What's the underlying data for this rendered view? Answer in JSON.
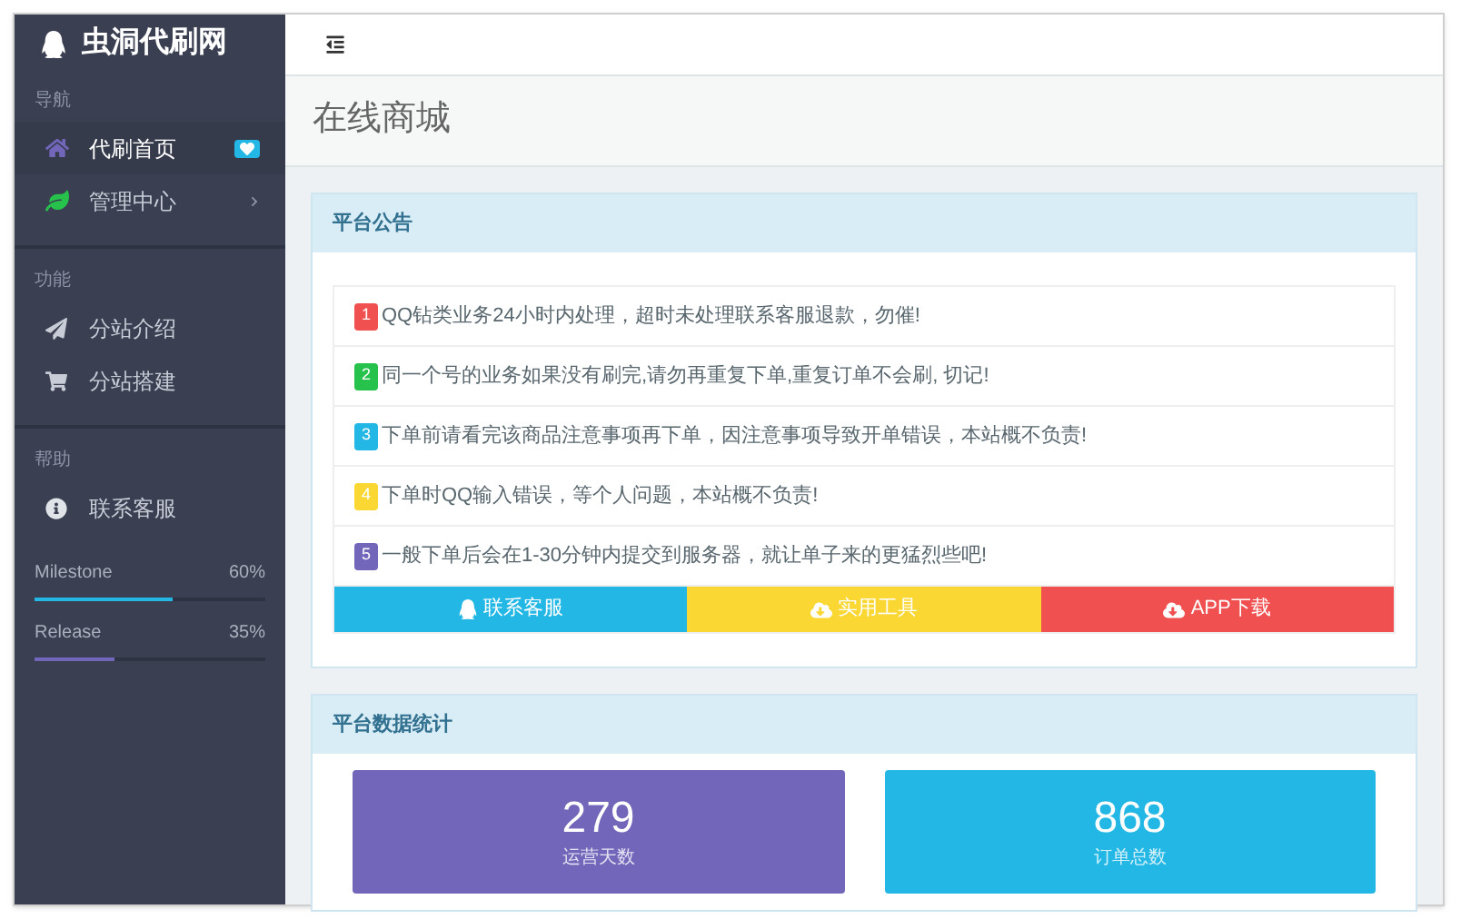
{
  "sidebar": {
    "brand": "虫洞代刷网",
    "sections": [
      {
        "heading": "导航",
        "items": [
          {
            "label": "代刷首页",
            "selected": true,
            "badge": true,
            "expandable": false
          },
          {
            "label": "管理中心",
            "selected": false,
            "badge": false,
            "expandable": true
          }
        ]
      },
      {
        "heading": "功能",
        "items": [
          {
            "label": "分站介绍",
            "selected": false,
            "badge": false,
            "expandable": false
          },
          {
            "label": "分站搭建",
            "selected": false,
            "badge": false,
            "expandable": false
          }
        ]
      },
      {
        "heading": "帮助",
        "items": [
          {
            "label": "联系客服",
            "selected": false,
            "badge": false,
            "expandable": false
          }
        ]
      }
    ],
    "progress": [
      {
        "label": "Milestone",
        "reading": "60%",
        "level": 0.6,
        "color": "#23b7e5"
      },
      {
        "label": "Release",
        "reading": "35%",
        "level": 0.35,
        "color": "#7266ba"
      }
    ]
  },
  "page_title": "在线商城",
  "notice": {
    "title": "平台公告",
    "items": [
      {
        "number": "1",
        "color": "#f05050",
        "text": "QQ钻类业务24小时内处理，超时未处理联系客服退款，勿催!"
      },
      {
        "number": "2",
        "color": "#27c24c",
        "text": "同一个号的业务如果没有刷完,请勿再重复下单,重复订单不会刷, 切记!"
      },
      {
        "number": "3",
        "color": "#23b7e5",
        "text": "下单前请看完该商品注意事项再下单，因注意事项导致开单错误，本站概不负责!"
      },
      {
        "number": "4",
        "color": "#fad733",
        "text": "下单时QQ输入错误，等个人问题，本站概不负责!"
      },
      {
        "number": "5",
        "color": "#7266ba",
        "text": "一般下单后会在1-30分钟内提交到服务器，就让单子来的更猛烈些吧!"
      }
    ],
    "buttons": [
      {
        "label": "联系客服",
        "color": "#23b7e5"
      },
      {
        "label": "实用工具",
        "color": "#fad733"
      },
      {
        "label": "APP下载",
        "color": "#f05050"
      }
    ]
  },
  "stats": {
    "title": "平台数据统计",
    "cards": [
      {
        "value": "279",
        "label": "运营天数",
        "color": "#7266ba"
      },
      {
        "value": "868",
        "label": "订单总数",
        "color": "#23b7e5"
      }
    ]
  }
}
